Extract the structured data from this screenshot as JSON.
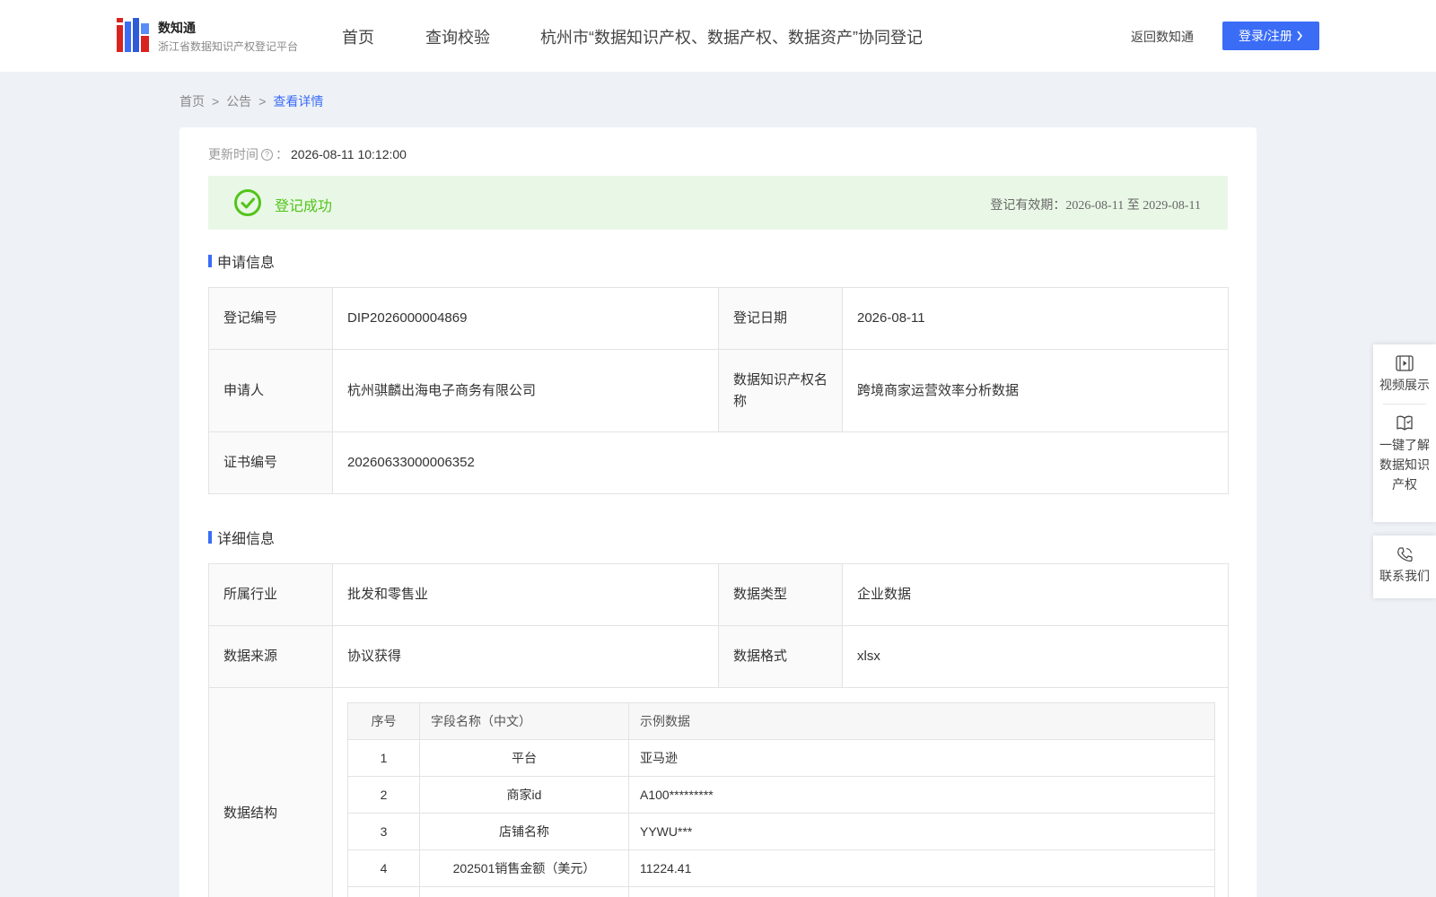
{
  "header": {
    "brand_title": "数知通",
    "brand_subtitle": "浙江省数据知识产权登记平台",
    "nav": [
      "首页",
      "查询校验",
      "杭州市“数据知识产权、数据产权、数据资产”协同登记"
    ],
    "back_link": "返回数知通",
    "login_label": "登录/注册"
  },
  "breadcrumb": {
    "items": [
      "首页",
      "公告",
      "查看详情"
    ],
    "separator": ">"
  },
  "update": {
    "label": "更新时间",
    "colon": "：",
    "value": "2026-08-11 10:12:00"
  },
  "status": {
    "text": "登记成功",
    "validity": "登记有效期：2026-08-11 至 2029-08-11",
    "color": "#52c41a"
  },
  "application": {
    "title": "申请信息",
    "reg_no_label": "登记编号",
    "reg_no": "DIP2026000004869",
    "reg_date_label": "登记日期",
    "reg_date": "2026-08-11",
    "applicant_label": "申请人",
    "applicant": "杭州骐麟出海电子商务有限公司",
    "ip_name_label": "数据知识产权名称",
    "ip_name": "跨境商家运营效率分析数据",
    "cert_no_label": "证书编号",
    "cert_no": "20260633000006352"
  },
  "details": {
    "title": "详细信息",
    "industry_label": "所属行业",
    "industry": "批发和零售业",
    "data_type_label": "数据类型",
    "data_type": "企业数据",
    "source_label": "数据来源",
    "source": "协议获得",
    "format_label": "数据格式",
    "format": "xlsx",
    "structure_label": "数据结构",
    "fields_header": [
      "序号",
      "字段名称（中文）",
      "示例数据"
    ],
    "fields": [
      [
        "1",
        "平台",
        "亚马逊"
      ],
      [
        "2",
        "商家id",
        "A100*********"
      ],
      [
        "3",
        "店铺名称",
        "YYWU***"
      ],
      [
        "4",
        "202501销售金额（美元）",
        "11224.41"
      ],
      [
        "",
        "",
        ""
      ]
    ]
  },
  "side_panel": {
    "video": "视频展示",
    "learn": "一键了解数据知识产权",
    "contact": "联系我们"
  },
  "colors": {
    "accent": "#3a6cf6",
    "success_bg": "#e9f8e6",
    "page_bg": "#eef2f6"
  }
}
